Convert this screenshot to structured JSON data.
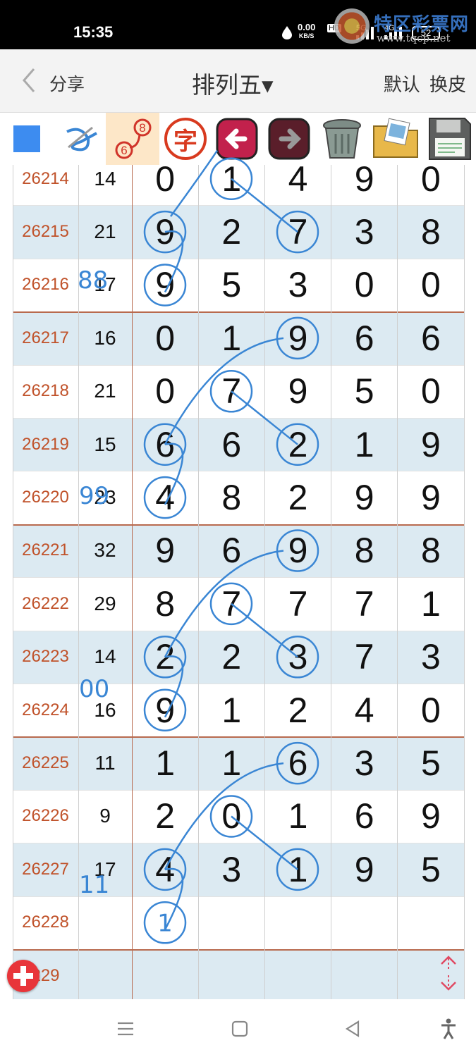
{
  "status": {
    "time": "15:35",
    "rate_value": "0.00",
    "rate_unit": "KB/S",
    "hd": "HD",
    "net1": "5G",
    "net2": "4G",
    "battery": "52"
  },
  "watermark": {
    "brand": "特区彩票网",
    "url": "www.tqcp.net"
  },
  "nav": {
    "share": "分享",
    "title": "排列五▾",
    "default": "默认",
    "skin": "换皮"
  },
  "toolbar": {
    "char_label": "字",
    "chain_top": "8",
    "chain_bottom": "6"
  },
  "rows": [
    {
      "period": "26214",
      "sum": "14",
      "digits": [
        "0",
        "1",
        "4",
        "9",
        "0"
      ]
    },
    {
      "period": "26215",
      "sum": "21",
      "digits": [
        "9",
        "2",
        "7",
        "3",
        "8"
      ]
    },
    {
      "period": "26216",
      "sum": "17",
      "digits": [
        "9",
        "5",
        "3",
        "0",
        "0"
      ]
    },
    {
      "period": "26217",
      "sum": "16",
      "digits": [
        "0",
        "1",
        "9",
        "6",
        "6"
      ]
    },
    {
      "period": "26218",
      "sum": "21",
      "digits": [
        "0",
        "7",
        "9",
        "5",
        "0"
      ]
    },
    {
      "period": "26219",
      "sum": "15",
      "digits": [
        "6",
        "6",
        "2",
        "1",
        "9"
      ]
    },
    {
      "period": "26220",
      "sum": "23",
      "digits": [
        "4",
        "8",
        "2",
        "9",
        "9"
      ]
    },
    {
      "period": "26221",
      "sum": "32",
      "digits": [
        "9",
        "6",
        "9",
        "8",
        "8"
      ]
    },
    {
      "period": "26222",
      "sum": "29",
      "digits": [
        "8",
        "7",
        "7",
        "7",
        "1"
      ]
    },
    {
      "period": "26223",
      "sum": "14",
      "digits": [
        "2",
        "2",
        "3",
        "7",
        "3"
      ]
    },
    {
      "period": "26224",
      "sum": "16",
      "digits": [
        "9",
        "1",
        "2",
        "4",
        "0"
      ]
    },
    {
      "period": "26225",
      "sum": "11",
      "digits": [
        "1",
        "1",
        "6",
        "3",
        "5"
      ]
    },
    {
      "period": "26226",
      "sum": "9",
      "digits": [
        "2",
        "0",
        "1",
        "6",
        "9"
      ]
    },
    {
      "period": "26227",
      "sum": "17",
      "digits": [
        "4",
        "3",
        "1",
        "9",
        "5"
      ]
    },
    {
      "period": "26228",
      "sum": "",
      "digits": [
        "",
        "",
        "",
        "",
        ""
      ]
    },
    {
      "period": "229",
      "sum": "",
      "digits": [
        "",
        "",
        "",
        "",
        ""
      ]
    }
  ],
  "annotations": {
    "notes": [
      "88",
      "99",
      "00",
      "11"
    ],
    "predicted_digit": "1"
  },
  "colors": {
    "period_text": "#c0522a",
    "alt_row": "#dceaf2",
    "handwriting": "#3a86d4",
    "group_separator": "#b86a4e"
  }
}
